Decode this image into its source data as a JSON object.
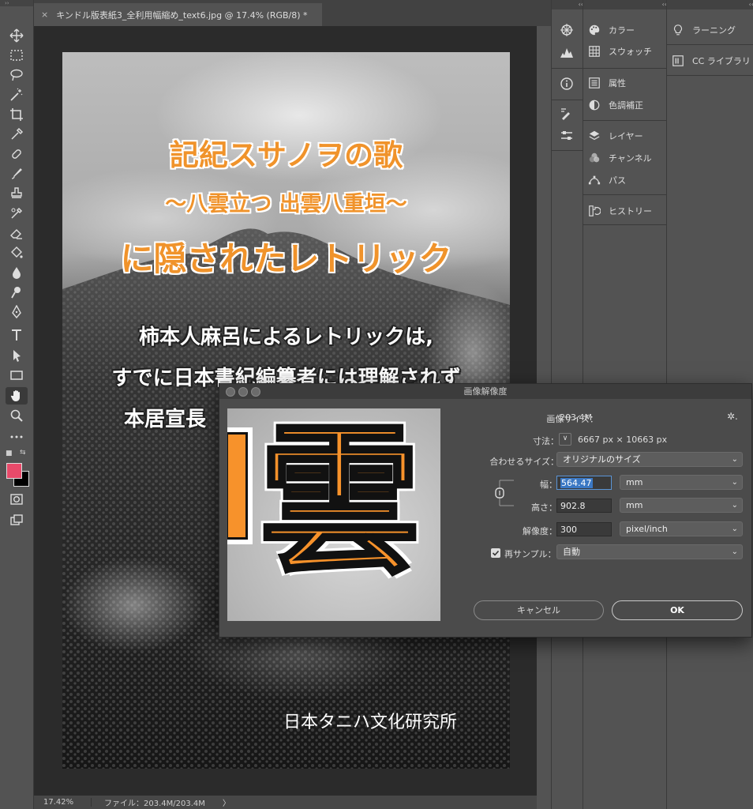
{
  "document": {
    "tab_title": "キンドル版表紙3_全利用幅縮め_text6.jpg @ 17.4% (RGB/8) *",
    "close_glyph": "×"
  },
  "artwork": {
    "title_line1": "記紀スサノヲの歌",
    "title_line2": "〜八雲立つ 出雲八重垣〜",
    "title_line3": "に隠されたレトリック",
    "body_line1": "柿本人麻呂によるレトリックは,",
    "body_line2": "すでに日本書紀編纂者には理解されず",
    "body_line3": "本居宣長",
    "publisher": "日本タニハ文化研究所"
  },
  "status": {
    "zoom": "17.42%",
    "file_info": "ファイル：203.4M/203.4M",
    "arrow": "〉"
  },
  "panels": {
    "col2": [
      {
        "label": "カラー",
        "icon": "palette-icon"
      },
      {
        "label": "スウォッチ",
        "icon": "grid-icon"
      },
      {
        "label": "属性",
        "icon": "properties-icon"
      },
      {
        "label": "色調補正",
        "icon": "adjustments-icon"
      },
      {
        "label": "レイヤー",
        "icon": "layers-icon"
      },
      {
        "label": "チャンネル",
        "icon": "channels-icon"
      },
      {
        "label": "パス",
        "icon": "paths-icon"
      },
      {
        "label": "ヒストリー",
        "icon": "history-icon"
      }
    ],
    "col3": [
      {
        "label": "ラーニング",
        "icon": "lightbulb-icon"
      },
      {
        "label": "CC ライブラリ",
        "icon": "cc-libraries-icon"
      }
    ]
  },
  "dialog": {
    "title": "画像解像度",
    "preview_glyph": "雲",
    "image_size_label": "画像サイズ：",
    "image_size_value": "203.4M",
    "dimensions_label": "寸法：",
    "dimensions_value": "6667 px × 10663 px",
    "fit_to_label": "合わせるサイズ：",
    "fit_to_value": "オリジナルのサイズ",
    "width_label": "幅：",
    "width_value": "564.47",
    "width_unit": "mm",
    "height_label": "高さ：",
    "height_value": "902.8",
    "height_unit": "mm",
    "resolution_label": "解像度：",
    "resolution_value": "300",
    "resolution_unit": "pixel/inch",
    "resample_label": "再サンプル：",
    "resample_checked": true,
    "resample_value": "自動",
    "cancel_label": "キャンセル",
    "ok_label": "OK"
  },
  "colors": {
    "foreground": "#e84a6a",
    "background": "#000000",
    "title_orange": "#f0932b",
    "selection_blue": "#3b78c4"
  }
}
